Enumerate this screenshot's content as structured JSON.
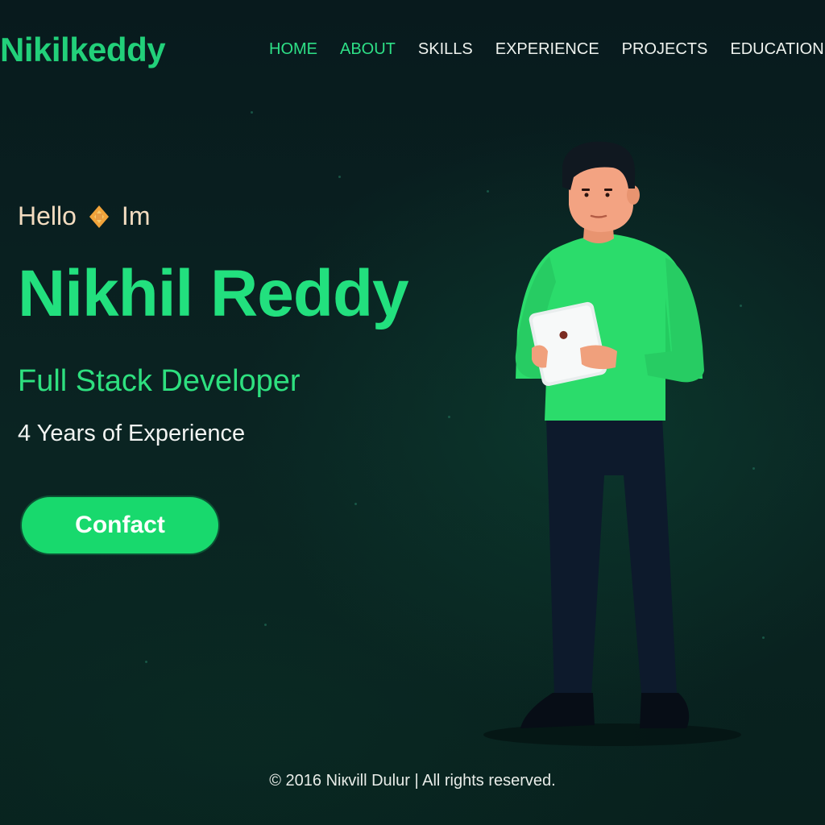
{
  "header": {
    "logo": "Nikilkeddy",
    "nav": [
      {
        "label": "HOME",
        "active": true
      },
      {
        "label": "ABOUT",
        "active": true
      },
      {
        "label": "SKILLS",
        "active": false
      },
      {
        "label": "EXPERIENCE",
        "active": false
      },
      {
        "label": "PROJECTS",
        "active": false
      },
      {
        "label": "EDUCATION",
        "active": false
      }
    ]
  },
  "hero": {
    "greeting_start": "Hello",
    "greeting_end": "Im",
    "greeting_icon": "sparkle-icon",
    "name": "Nikhil Reddy",
    "role": "Full Stack Developer",
    "experience": "4 Years of Experience",
    "contact_label": "Confact"
  },
  "illustration": {
    "subject": "developer-holding-tablet"
  },
  "footer": {
    "copyright": "© 2016 Niкvill Dulur | All rights reserved."
  },
  "colors": {
    "accent": "#22e07e",
    "button": "#18d96d",
    "background": "#07181a",
    "greeting": "#f3dcc0"
  }
}
